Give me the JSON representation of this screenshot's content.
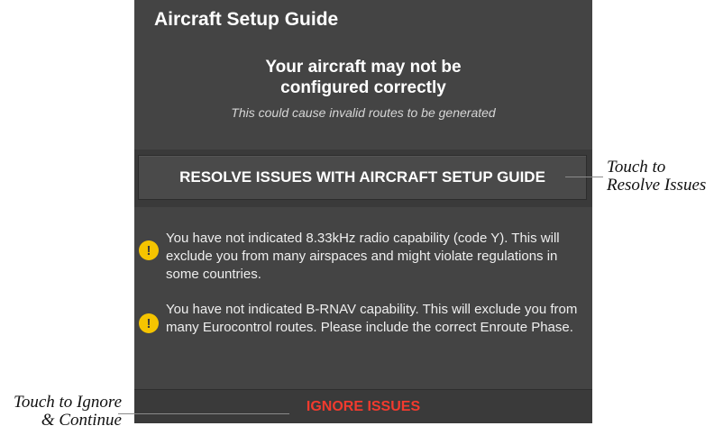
{
  "dialog": {
    "title": "Aircraft Setup Guide",
    "headline_line1": "Your aircraft may not be",
    "headline_line2": "configured correctly",
    "subtext": "This could cause invalid routes to be generated",
    "resolve_button_label": "RESOLVE ISSUES WITH AIRCRAFT SETUP GUIDE",
    "warnings": [
      {
        "icon": "warning-icon",
        "icon_glyph": "!",
        "text": "You have not indicated 8.33kHz radio capability (code Y). This will exclude you from many airspaces and might violate regulations in some countries."
      },
      {
        "icon": "warning-icon",
        "icon_glyph": "!",
        "text": "You have not indicated B-RNAV capability. This will exclude you from many Eurocontrol routes. Please include the correct Enroute Phase."
      }
    ],
    "ignore_button_label": "IGNORE ISSUES"
  },
  "callouts": {
    "resolve_line1": "Touch to",
    "resolve_line2": "Resolve Issues",
    "ignore_line1": "Touch to Ignore",
    "ignore_line2": "& Continue"
  },
  "colors": {
    "dialog_background": "#444444",
    "band_background": "#3a3a3a",
    "warning_icon": "#f5c400",
    "ignore_text": "#f23a2e",
    "text_primary": "#ffffff"
  }
}
